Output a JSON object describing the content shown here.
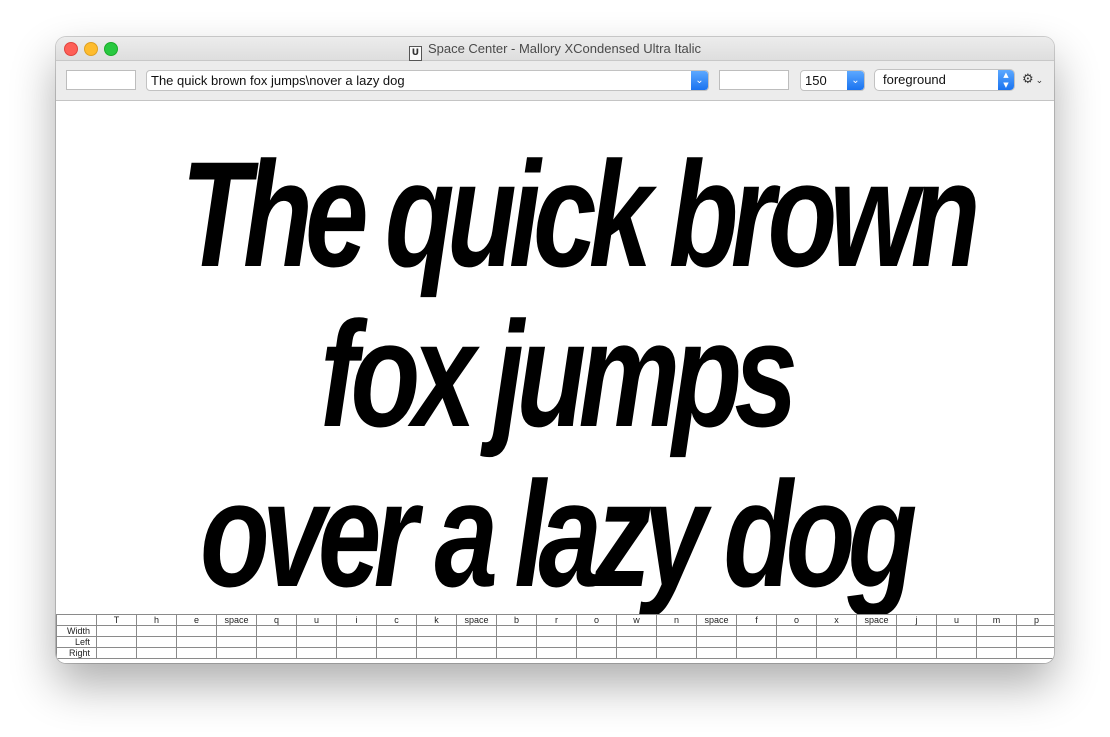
{
  "window": {
    "title": "Space Center - Mallory XCondensed Ultra Italic",
    "doc_icon": "U"
  },
  "toolbar": {
    "left_field": "",
    "text_input": "The quick brown fox jumps\\nover a lazy dog",
    "suffix_field": "",
    "size": "150",
    "layer": "foreground",
    "settings_icon": "gear-icon"
  },
  "sample": {
    "lines": [
      "The quick brown",
      "fox jumps",
      "over a lazy dog"
    ]
  },
  "metrics": {
    "glyphs": [
      "T",
      "h",
      "e",
      "space",
      "q",
      "u",
      "i",
      "c",
      "k",
      "space",
      "b",
      "r",
      "o",
      "w",
      "n",
      "space",
      "f",
      "o",
      "x",
      "space",
      "j",
      "u",
      "m",
      "p"
    ],
    "row_labels": [
      "Width",
      "Left",
      "Right"
    ]
  }
}
